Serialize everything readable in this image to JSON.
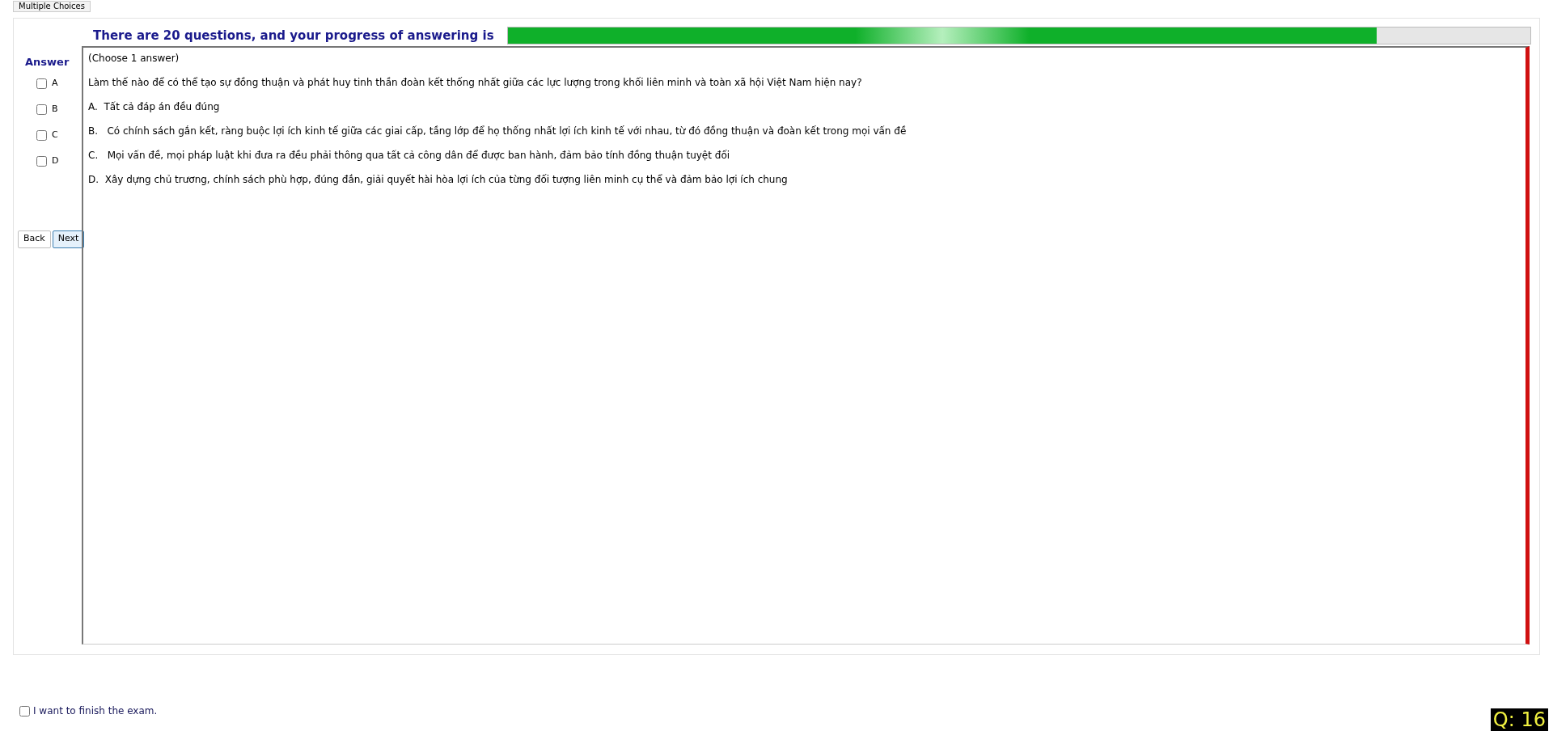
{
  "tab": {
    "label": "Multiple Choices"
  },
  "progress": {
    "label": "There are 20 questions, and your progress of answering is",
    "level": 0.85
  },
  "answer_panel": {
    "title": "Answer",
    "options": [
      {
        "label": "A",
        "checked": false
      },
      {
        "label": "B",
        "checked": false
      },
      {
        "label": "C",
        "checked": false
      },
      {
        "label": "D",
        "checked": false
      }
    ],
    "buttons": [
      {
        "label": "Back",
        "selected": false
      },
      {
        "label": "Next",
        "selected": true
      }
    ]
  },
  "question": {
    "instruction": "(Choose 1 answer)",
    "text": "Làm thế nào để có thể tạo sự đồng thuận và phát huy tinh thần đoàn kết thống nhất giữa các lực lượng trong khối liên minh và toàn xã hội Việt Nam hiện nay?",
    "choices": [
      "A.  Tất cả đáp án đều đúng",
      "B.   Có chính sách gắn kết, ràng buộc lợi ích kinh tế giữa các giai cấp, tầng lớp để họ thống nhất lợi ích kinh tế với nhau, từ đó đồng thuận và đoàn kết trong mọi vấn đề",
      "C.   Mọi vấn đề, mọi pháp luật khi đưa ra đều phải thông qua tất cả công dân để được ban hành, đảm bảo tính đồng thuận tuyệt đối",
      "D.  Xây dựng chủ trương, chính sách phù hợp, đúng đắn, giải quyết hài hòa lợi ích của từng đối tượng liên minh cụ thể và đảm bảo lợi ích chung"
    ]
  },
  "finish": {
    "label": "I want to finish the exam.",
    "checked": false
  },
  "question_counter": "Q: 16"
}
